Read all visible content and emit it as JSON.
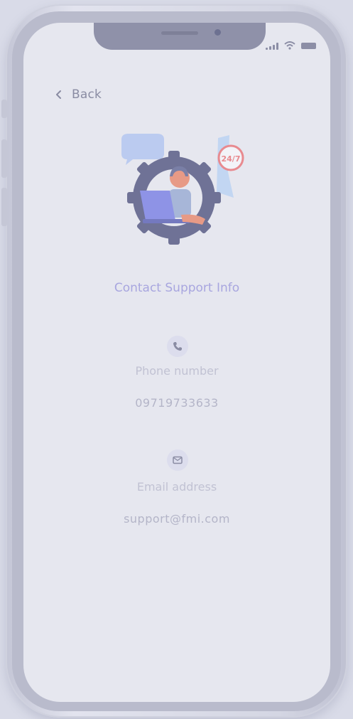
{
  "header": {
    "back_label": "Back"
  },
  "title": "Contact Support Info",
  "illustration": {
    "badge_text": "24/7"
  },
  "phone": {
    "label": "Phone number",
    "value": "09719733633"
  },
  "email": {
    "label": "Email address",
    "value": "support@fmi.com"
  },
  "colors": {
    "accent": "#a8a6df",
    "screen_bg": "#e6e7ef",
    "badge": "#e88a8f"
  },
  "icons": [
    "chevron-left-icon",
    "phone-icon",
    "mail-icon",
    "signal-icon",
    "wifi-icon",
    "battery-icon"
  ]
}
